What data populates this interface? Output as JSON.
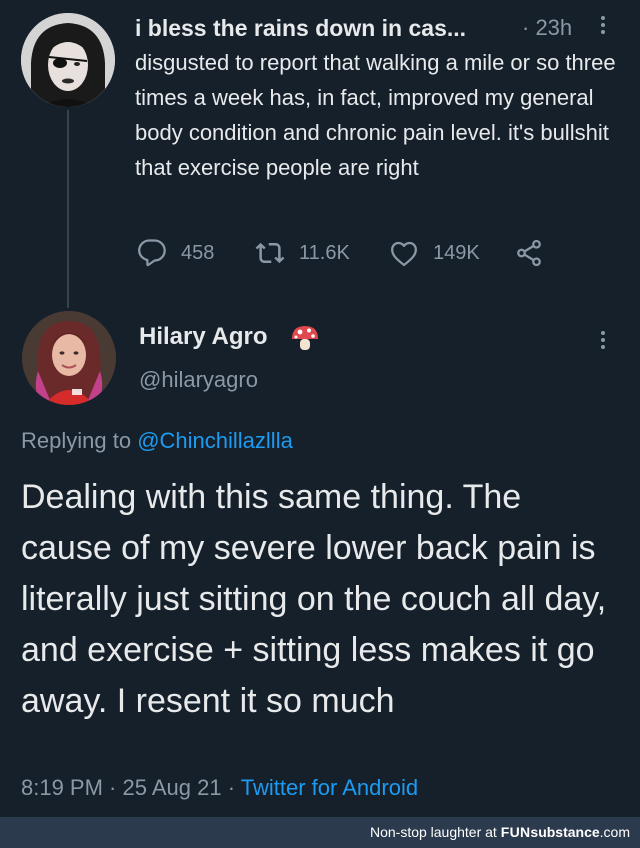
{
  "top_tweet": {
    "display_name": "i bless the rains down in cas...",
    "time": "· 23h",
    "text": "disgusted to report that walking a mile or so three times a week has, in fact, improved my general body condition and chronic pain level. it's bullshit that exercise people are right",
    "replies": "458",
    "retweets": "11.6K",
    "likes": "149K",
    "icons": [
      "reply-icon",
      "retweet-icon",
      "heart-icon",
      "share-icon",
      "more-icon"
    ]
  },
  "main_tweet": {
    "display_name": "Hilary Agro",
    "emoji": "mushroom-icon",
    "handle": "@hilaryagro",
    "replying_prefix": "Replying to",
    "replying_to": "@Chinchillazllla",
    "text": "Dealing with this same thing. The cause of my severe lower back pain is literally just sitting on the couch all day, and exercise + sitting less makes it go away. I resent it so much",
    "time": "8:19 PM",
    "sep1": " · ",
    "date": "25 Aug 21",
    "sep2": " · ",
    "source": "Twitter for Android"
  },
  "footer": {
    "prefix": "Non-stop laughter at ",
    "brand": "FUN",
    "brand2": "substance",
    "suffix": ".com"
  },
  "colors": {
    "background": "#15202b",
    "text": "#e7e9ea",
    "muted": "#8b98a5",
    "link": "#1d9bf0",
    "footer_bar": "#2b3a4d"
  }
}
